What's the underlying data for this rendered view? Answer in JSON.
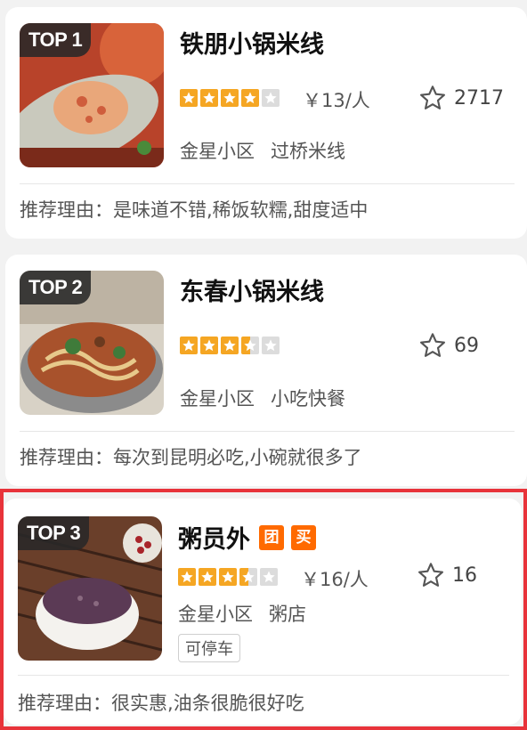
{
  "colors": {
    "accent": "#e8333a",
    "star": "#f5a623",
    "tag": "#ff6a00"
  },
  "cards": [
    {
      "rank": "TOP 1",
      "name": "铁朋小锅米线",
      "rating": 4,
      "price": "￥13/人",
      "favorites": "2717",
      "area": "金星小区",
      "category": "过桥米线",
      "reason": "推荐理由：是味道不错,稀饭软糯,甜度适中"
    },
    {
      "rank": "TOP 2",
      "name": "东春小锅米线",
      "rating": 3.5,
      "favorites": "69",
      "area": "金星小区",
      "category": "小吃快餐",
      "reason": "推荐理由：每次到昆明必吃,小碗就很多了"
    },
    {
      "rank": "TOP 3",
      "name": "粥员外",
      "tags": [
        "团",
        "买"
      ],
      "rating": 3.5,
      "price": "￥16/人",
      "favorites": "16",
      "area": "金星小区",
      "category": "粥店",
      "feature": "可停车",
      "reason": "推荐理由：很实惠,油条很脆很好吃"
    }
  ],
  "icons": {
    "favorite": "star-outline-icon",
    "rating": "star-filled-icon"
  }
}
